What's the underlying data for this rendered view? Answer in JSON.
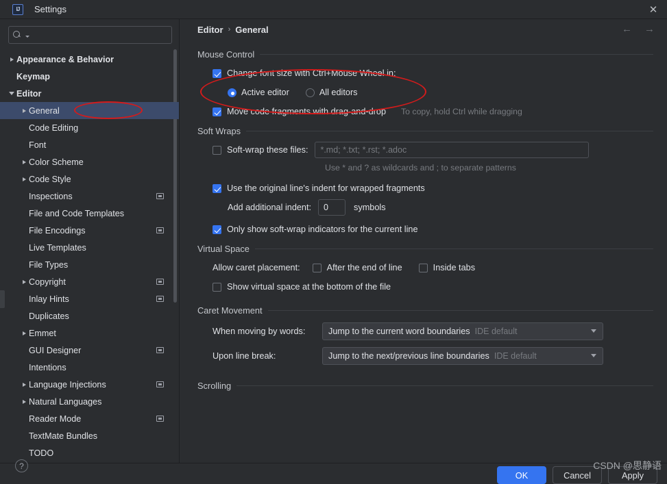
{
  "window": {
    "title": "Settings",
    "logo_icon": "intellij-idea-logo",
    "close_icon": "close-icon"
  },
  "sidebar": {
    "search": {
      "placeholder": "",
      "value": "",
      "icon": "search-icon",
      "caret_icon": "chevron-down-icon"
    },
    "items": [
      {
        "label": "Appearance & Behavior",
        "indent": 0,
        "arrow": "collapsed",
        "bold": true,
        "badge": false,
        "selected": false
      },
      {
        "label": "Keymap",
        "indent": 0,
        "arrow": "none",
        "bold": true,
        "badge": false,
        "selected": false
      },
      {
        "label": "Editor",
        "indent": 0,
        "arrow": "expanded",
        "bold": true,
        "badge": false,
        "selected": false
      },
      {
        "label": "General",
        "indent": 1,
        "arrow": "collapsed",
        "bold": false,
        "badge": false,
        "selected": true
      },
      {
        "label": "Code Editing",
        "indent": 1,
        "arrow": "none",
        "bold": false,
        "badge": false,
        "selected": false
      },
      {
        "label": "Font",
        "indent": 1,
        "arrow": "none",
        "bold": false,
        "badge": false,
        "selected": false
      },
      {
        "label": "Color Scheme",
        "indent": 1,
        "arrow": "collapsed",
        "bold": false,
        "badge": false,
        "selected": false
      },
      {
        "label": "Code Style",
        "indent": 1,
        "arrow": "collapsed",
        "bold": false,
        "badge": false,
        "selected": false
      },
      {
        "label": "Inspections",
        "indent": 1,
        "arrow": "none",
        "bold": false,
        "badge": true,
        "selected": false
      },
      {
        "label": "File and Code Templates",
        "indent": 1,
        "arrow": "none",
        "bold": false,
        "badge": false,
        "selected": false
      },
      {
        "label": "File Encodings",
        "indent": 1,
        "arrow": "none",
        "bold": false,
        "badge": true,
        "selected": false
      },
      {
        "label": "Live Templates",
        "indent": 1,
        "arrow": "none",
        "bold": false,
        "badge": false,
        "selected": false
      },
      {
        "label": "File Types",
        "indent": 1,
        "arrow": "none",
        "bold": false,
        "badge": false,
        "selected": false
      },
      {
        "label": "Copyright",
        "indent": 1,
        "arrow": "collapsed",
        "bold": false,
        "badge": true,
        "selected": false
      },
      {
        "label": "Inlay Hints",
        "indent": 1,
        "arrow": "none",
        "bold": false,
        "badge": true,
        "selected": false
      },
      {
        "label": "Duplicates",
        "indent": 1,
        "arrow": "none",
        "bold": false,
        "badge": false,
        "selected": false
      },
      {
        "label": "Emmet",
        "indent": 1,
        "arrow": "collapsed",
        "bold": false,
        "badge": false,
        "selected": false
      },
      {
        "label": "GUI Designer",
        "indent": 1,
        "arrow": "none",
        "bold": false,
        "badge": true,
        "selected": false
      },
      {
        "label": "Intentions",
        "indent": 1,
        "arrow": "none",
        "bold": false,
        "badge": false,
        "selected": false
      },
      {
        "label": "Language Injections",
        "indent": 1,
        "arrow": "collapsed",
        "bold": false,
        "badge": true,
        "selected": false
      },
      {
        "label": "Natural Languages",
        "indent": 1,
        "arrow": "collapsed",
        "bold": false,
        "badge": false,
        "selected": false
      },
      {
        "label": "Reader Mode",
        "indent": 1,
        "arrow": "none",
        "bold": false,
        "badge": true,
        "selected": false
      },
      {
        "label": "TextMate Bundles",
        "indent": 1,
        "arrow": "none",
        "bold": false,
        "badge": false,
        "selected": false
      },
      {
        "label": "TODO",
        "indent": 1,
        "arrow": "none",
        "bold": false,
        "badge": false,
        "selected": false
      }
    ]
  },
  "breadcrumb": {
    "parent": "Editor",
    "separator": "›",
    "current": "General",
    "back_icon": "arrow-left-icon",
    "forward_icon": "arrow-right-icon"
  },
  "sections": {
    "mouse_control": {
      "title": "Mouse Control",
      "change_font_size": {
        "label": "Change font size with Ctrl+Mouse Wheel in:",
        "checked": true
      },
      "scope_active": {
        "label": "Active editor",
        "selected": true
      },
      "scope_all": {
        "label": "All editors",
        "selected": false
      },
      "drag_and_drop": {
        "label": "Move code fragments with drag-and-drop",
        "checked": true
      },
      "drag_and_drop_hint": "To copy, hold Ctrl while dragging"
    },
    "soft_wraps": {
      "title": "Soft Wraps",
      "soft_wrap_files": {
        "label": "Soft-wrap these files:",
        "checked": false
      },
      "soft_wrap_files_value": "*.md; *.txt; *.rst; *.adoc",
      "wildcard_hint": "Use * and ? as wildcards and ; to separate patterns",
      "original_indent": {
        "label": "Use the original line's indent for wrapped fragments",
        "checked": true
      },
      "additional_indent_label": "Add additional indent:",
      "additional_indent_value": "0",
      "additional_indent_unit": "symbols",
      "only_show_indicators": {
        "label": "Only show soft-wrap indicators for the current line",
        "checked": true
      }
    },
    "virtual_space": {
      "title": "Virtual Space",
      "allow_caret_label": "Allow caret placement:",
      "after_end_of_line": {
        "label": "After the end of line",
        "checked": false
      },
      "inside_tabs": {
        "label": "Inside tabs",
        "checked": false
      },
      "show_virtual_space": {
        "label": "Show virtual space at the bottom of the file",
        "checked": false
      }
    },
    "caret_movement": {
      "title": "Caret Movement",
      "moving_by_words_label": "When moving by words:",
      "moving_by_words_value": "Jump to the current word boundaries",
      "moving_by_words_sub": "IDE default",
      "upon_line_break_label": "Upon line break:",
      "upon_line_break_value": "Jump to the next/previous line boundaries",
      "upon_line_break_sub": "IDE default",
      "dropdown_icon": "chevron-down-icon"
    },
    "scrolling": {
      "title": "Scrolling"
    }
  },
  "footer": {
    "help_icon": "?",
    "ok": "OK",
    "cancel": "Cancel",
    "apply": "Apply"
  },
  "watermark": "CSDN @思静语",
  "colors": {
    "accent": "#3574f0",
    "selection": "#3c4b6b",
    "background": "#2b2d30",
    "annotation": "#d41b1b"
  }
}
